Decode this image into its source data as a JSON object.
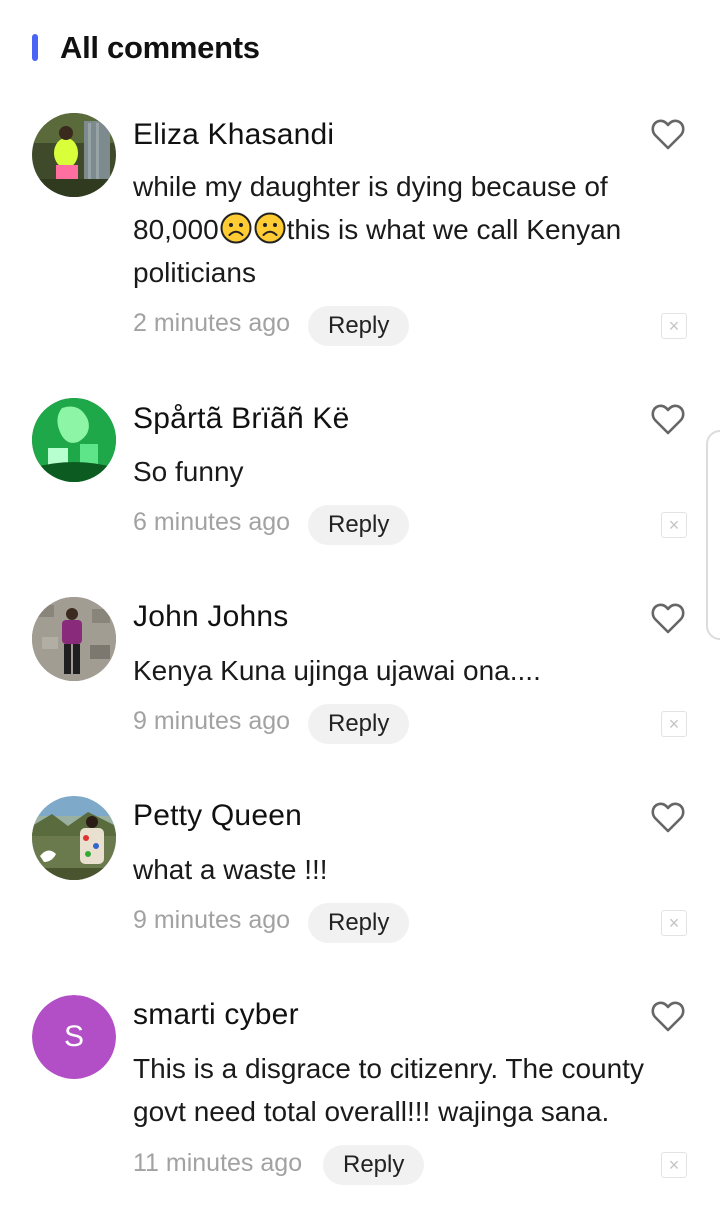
{
  "header": {
    "title": "All comments"
  },
  "comments": [
    {
      "name": "Eliza Khasandi",
      "text_parts": [
        "while my daughter is dying because of 80,000",
        "this is what we call Kenyan politicians"
      ],
      "time": "2 minutes ago",
      "reply_label": "Reply",
      "dismiss_glyph": "×"
    },
    {
      "name": "Spårtã Brïãñ Kë",
      "text": "So funny",
      "time": "6 minutes ago",
      "reply_label": "Reply",
      "dismiss_glyph": "×"
    },
    {
      "name": "John Johns",
      "text": "Kenya Kuna ujinga ujawai ona....",
      "time": "9 minutes ago",
      "reply_label": "Reply",
      "dismiss_glyph": "×"
    },
    {
      "name": "Petty Queen",
      "text": "what a waste !!!",
      "time": "9 minutes ago",
      "reply_label": "Reply",
      "dismiss_glyph": "×"
    },
    {
      "name": "smarti cyber",
      "avatar_letter": "S",
      "text": "This is a disgrace to citizenry. The county govt need total overall!!! wajinga sana.",
      "time": "11 minutes ago",
      "reply_label": "Reply",
      "dismiss_glyph": "×"
    }
  ],
  "icons": {
    "like": "heart-outline-icon",
    "dismiss": "close-icon",
    "emoji": "frowning-face-icon"
  },
  "colors": {
    "accent": "#4a64f5",
    "avatar_letter_bg": "#b24fc6",
    "timestamp": "#a2a2a2",
    "reply_bg": "#f1f1f1"
  }
}
